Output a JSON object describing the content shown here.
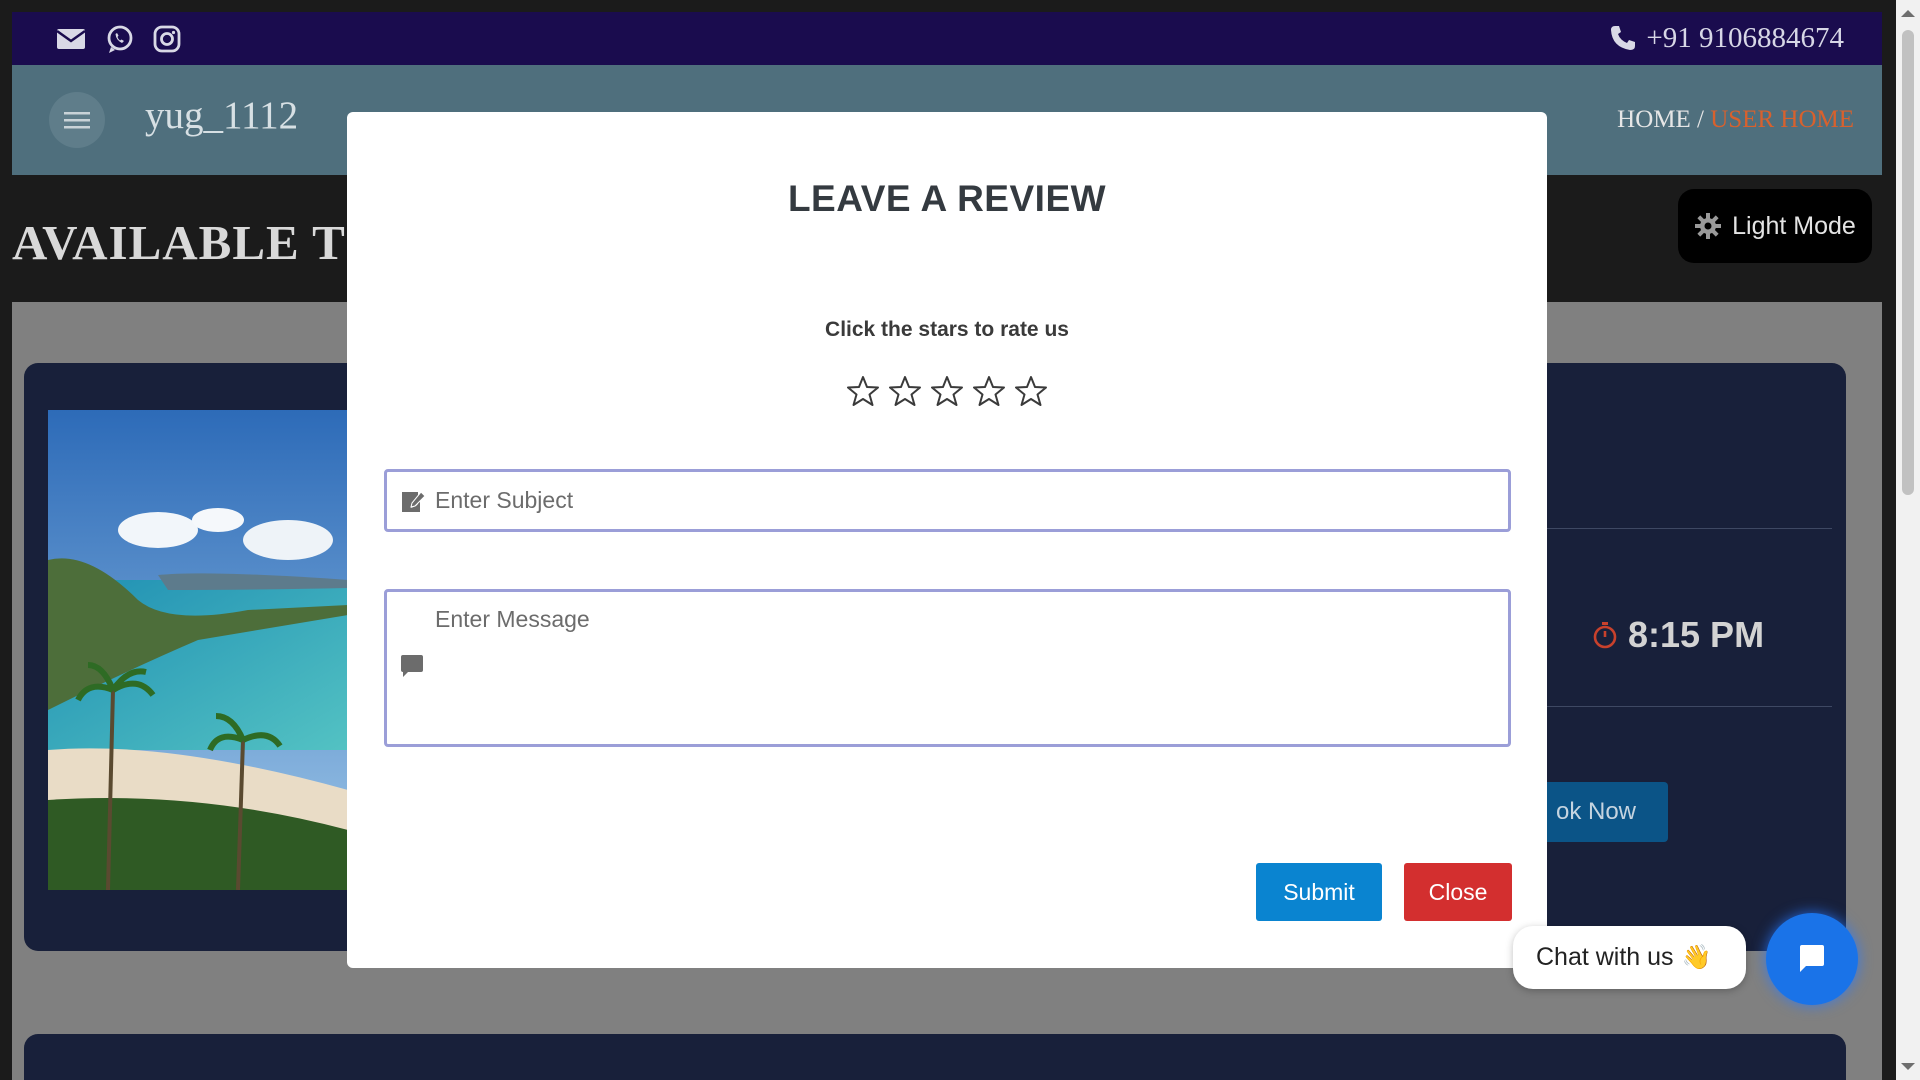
{
  "topbar": {
    "phone": "+91 9106884674",
    "icons": [
      "mail-icon",
      "whatsapp-icon",
      "instagram-icon",
      "phone-icon"
    ]
  },
  "header": {
    "brand": "yug_1112",
    "breadcrumb_home": "HOME",
    "breadcrumb_sep": " / ",
    "breadcrumb_current": "USER HOME"
  },
  "page": {
    "heading": "AVAILABLE TO",
    "theme_toggle": "Light Mode"
  },
  "card": {
    "time": "8:15 PM",
    "book_button": "ok Now"
  },
  "modal": {
    "title": "LEAVE A REVIEW",
    "rate_hint": "Click the stars to rate us",
    "rating": 0,
    "max_rating": 5,
    "subject_placeholder": "Enter Subject",
    "message_placeholder": "Enter Message",
    "submit_label": "Submit",
    "close_label": "Close"
  },
  "chat": {
    "label": "Chat with us",
    "emoji": "👋"
  },
  "colors": {
    "topbar": "#1a0c4e",
    "header": "#4f6f7d",
    "breadcrumb_active": "#d8612d",
    "submit": "#0a84d0",
    "close": "#d32f2f",
    "chat": "#1a73e8",
    "input_border": "#9b9ed8"
  }
}
